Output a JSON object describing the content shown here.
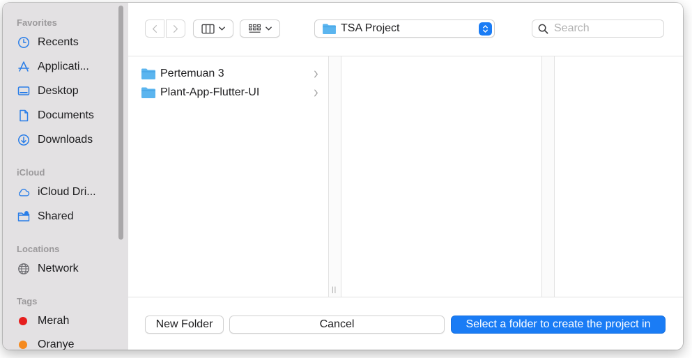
{
  "sidebar": {
    "sections": [
      {
        "title": "Favorites"
      },
      {
        "title": "iCloud"
      },
      {
        "title": "Locations"
      },
      {
        "title": "Tags"
      }
    ],
    "favorites": [
      {
        "label": "Recents",
        "icon": "clock-icon"
      },
      {
        "label": "Applicati...",
        "icon": "applications-icon"
      },
      {
        "label": "Desktop",
        "icon": "desktop-icon"
      },
      {
        "label": "Documents",
        "icon": "document-icon"
      },
      {
        "label": "Downloads",
        "icon": "download-icon"
      }
    ],
    "icloud": [
      {
        "label": "iCloud Dri...",
        "icon": "cloud-icon"
      },
      {
        "label": "Shared",
        "icon": "shared-folder-icon"
      }
    ],
    "locations": [
      {
        "label": "Network",
        "icon": "globe-icon"
      }
    ],
    "tags": [
      {
        "label": "Merah",
        "color": "#e61e1e"
      },
      {
        "label": "Oranye",
        "color": "#f58a1f"
      }
    ]
  },
  "toolbar": {
    "path_label": "TSA Project",
    "search_placeholder": "Search"
  },
  "browser": {
    "items": [
      {
        "label": "Pertemuan 3"
      },
      {
        "label": "Plant-App-Flutter-UI"
      }
    ]
  },
  "footer": {
    "new_folder": "New Folder",
    "cancel": "Cancel",
    "primary": "Select a folder to create the project in"
  },
  "colors": {
    "accent": "#1a7cf5",
    "folder": "#5bb5ef",
    "sidebar_icon": "#2a7ee8"
  }
}
